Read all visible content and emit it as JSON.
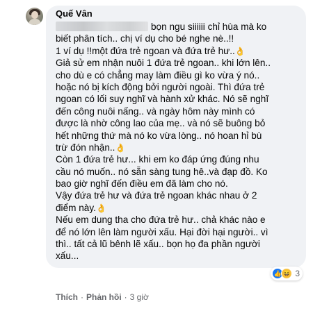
{
  "comment": {
    "author": "Quế Vân",
    "lines": [
      {
        "text": "bọn ngu siiiiii chỉ hùa mà ko",
        "redacted": true
      },
      {
        "text": "biết phân tích.. chị ví dụ cho bé nghe nè..!!"
      },
      {
        "text": "1 ví dụ !!một đứa trẻ ngoan và đứa trẻ hư..",
        "hand": "👌"
      },
      {
        "text": "Giả sử em nhận nuôi 1 đứa trẻ ngoan.. khi lớn lên.."
      },
      {
        "text": "cho dù e có chẳng may làm điều gì ko vừa ý nó.."
      },
      {
        "text": "hoặc nó bị kích động bởi người ngoài. Thì đứa trẻ"
      },
      {
        "text": "ngoan có lối suy nghĩ và hành xử khác. Nó sẽ nghĩ"
      },
      {
        "text": "đến công nuôi nấng.. và ngày hôm này mình có"
      },
      {
        "text": "được là nhờ công lao của mẹ.. và nó sẽ buông bỏ"
      },
      {
        "text": "hết những thứ mà nó ko vừa lòng.. nó hoan hỉ bù"
      },
      {
        "text": "trừ đón nhận..",
        "hand": "👌"
      },
      {
        "text": "Còn 1 đứa trẻ hư... khi em ko đáp ứng đúng nhu"
      },
      {
        "text": "cầu nó muốn.. nó sẵn sàng tung hê..và đạp đồ. Ko"
      },
      {
        "text": "bao giờ nghĩ đến điều em đã làm cho nó."
      },
      {
        "text": "Vậy đứa trẻ hư và đứa trẻ ngoan khác nhau ở 2"
      },
      {
        "text": "điểm này.",
        "hand": "👌"
      },
      {
        "text": "Nếu em dung tha cho đứa trẻ hư.. chả khác nào e"
      },
      {
        "text": "để nó lớn lên làm người xấu. Hại đời hại người.. vì"
      },
      {
        "text": "thì.. tất cả lũ bênh lẽ xấu.. bọn họ đa phần người"
      },
      {
        "text": "xấu..."
      }
    ]
  },
  "reactions": {
    "like_icon": "thumbs-up-icon",
    "haha_icon": "laugh-icon",
    "count": "3"
  },
  "actions": {
    "like": "Thích",
    "reply": "Phản hồi",
    "time": "3 giờ"
  },
  "colors": {
    "bubble": "#f0f2f5",
    "meta": "#65676b",
    "like_blue": "#1877f2"
  }
}
